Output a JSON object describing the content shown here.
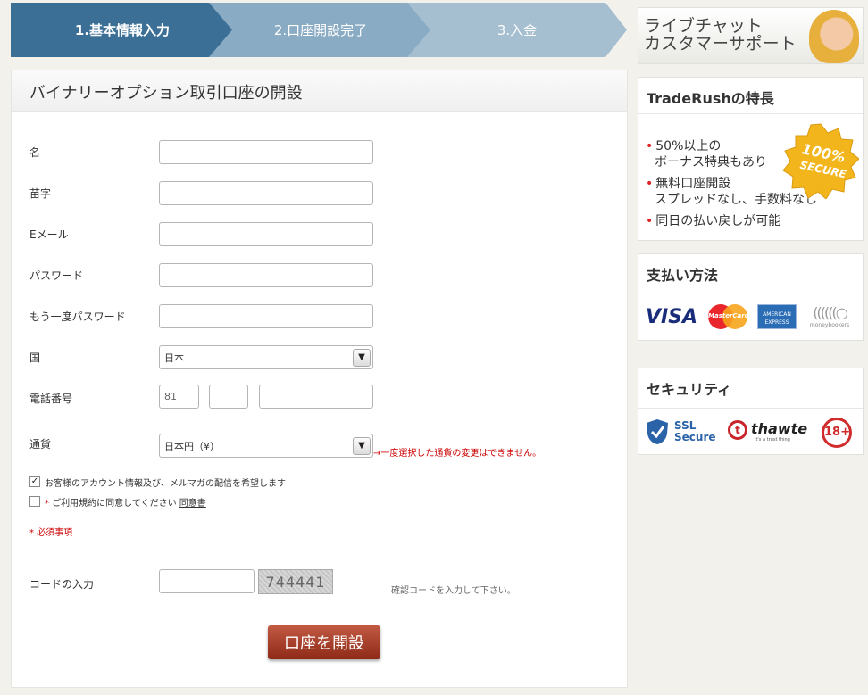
{
  "steps": [
    {
      "label": "1.基本情報入力",
      "state": "active"
    },
    {
      "label": "2.口座開設完了",
      "state": "inactive"
    },
    {
      "label": "3.入金",
      "state": "inactive"
    }
  ],
  "form": {
    "title": "バイナリーオプション取引口座の開設",
    "first_name_label": "名",
    "last_name_label": "苗字",
    "email_label": "Eメール",
    "password_label": "パスワード",
    "password_confirm_label": "もう一度パスワード",
    "country_label": "国",
    "country_value": "日本",
    "phone_label": "電話番号",
    "phone_code_value": "81",
    "currency_label": "通貨",
    "currency_value": "日本円（¥）",
    "currency_note": "一度選択した通貨の変更はできません。",
    "newsletter_label": "お客様のアカウント情報及び、メルマガの配信を希望します",
    "newsletter_checked": true,
    "terms_asterisk": "*",
    "terms_label": "ご利用規約に同意してください",
    "terms_link": "同意書",
    "required_note": "* 必須事項",
    "code_label": "コードの入力",
    "captcha_text": "744441",
    "code_hint": "確認コードを入力して下さい。",
    "submit_label": "口座を開設"
  },
  "sidebar": {
    "chat_line1": "ライブチャット",
    "chat_line2": "カスタマーサポート",
    "features_title": "TradeRushの特長",
    "features": [
      {
        "line1": "50%以上の",
        "line2": "ボーナス特典もあり"
      },
      {
        "line1": "無料口座開設",
        "line2": "スプレッドなし、手数料なし"
      },
      {
        "line1": "同日の払い戻しが可能",
        "line2": ""
      }
    ],
    "badge_line1": "100%",
    "badge_line2": "SECURE",
    "payment_title": "支払い方法",
    "payment_logos": {
      "visa": "VISA",
      "mastercard": "MasterCard",
      "amex_line1": "AMERICAN",
      "amex_line2": "EXPRESS",
      "moneybookers": "moneybookers"
    },
    "security_title": "セキュリティ",
    "security_logos": {
      "ssl_line1": "SSL",
      "ssl_line2": "Secure",
      "thawte": "thawte",
      "thawte_tag": "It's a trust thing",
      "age": "18+"
    }
  }
}
